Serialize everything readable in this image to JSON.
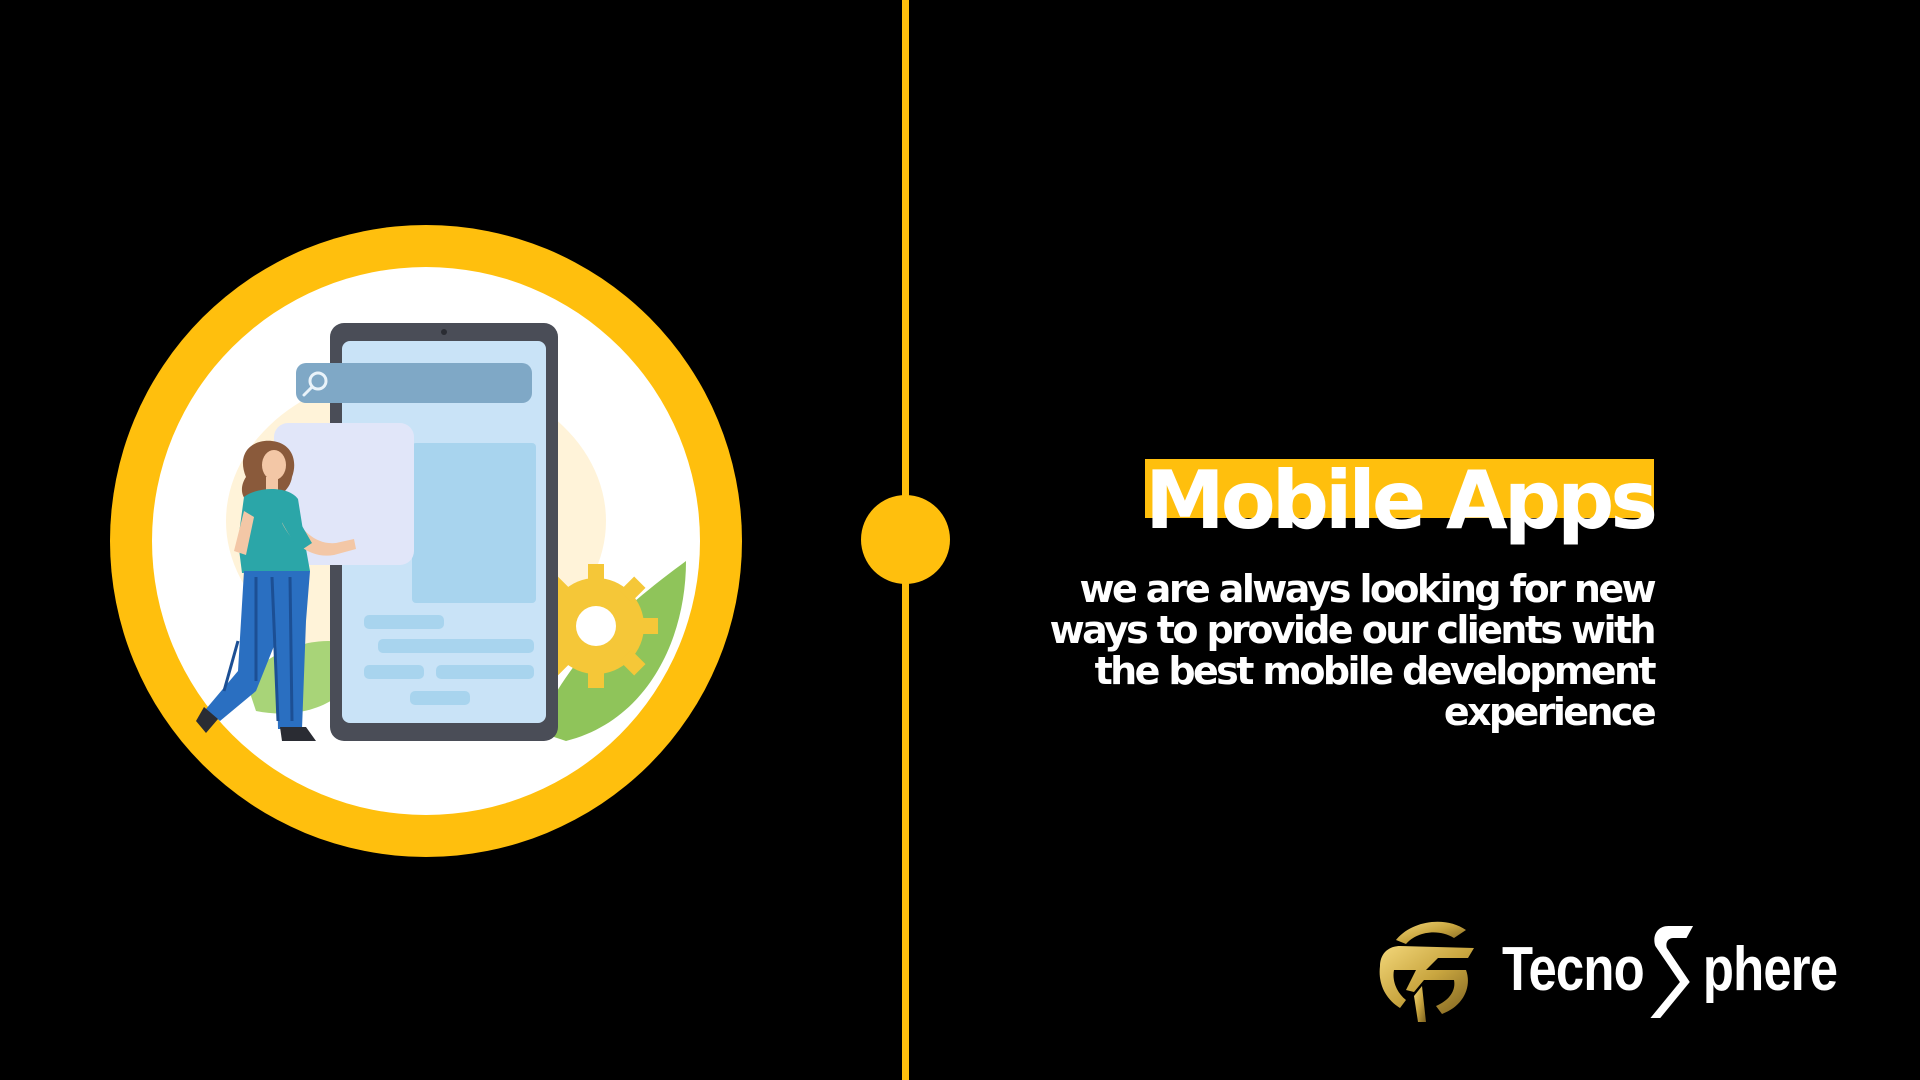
{
  "colors": {
    "background": "#000000",
    "accent": "#FFBF0D",
    "text": "#FFFFFF",
    "circle_inner": "#FFFFFF",
    "phone_frame": "#4A4D57",
    "phone_screen": "#C9E3F7",
    "search_bar": "#7FA8C6",
    "card": "#E1E6F9",
    "person_shirt": "#2BA6A8",
    "person_pants": "#2A6FC1",
    "person_hair": "#8A5A3B",
    "leaf": "#8FC45A",
    "gear": "#F5C738",
    "logo_gold": "#C9A640"
  },
  "illustration": {
    "name": "person-with-mobile-phone",
    "search_icon": "search-icon"
  },
  "main": {
    "heading": "Mobile Apps",
    "description_lines": [
      "we are always looking for new",
      "ways to provide our clients with",
      "the best mobile development",
      "experience"
    ]
  },
  "logo": {
    "text_before": "Tecno",
    "text_after": "phere",
    "mark_icon": "tecnosphere-emblem-icon"
  }
}
